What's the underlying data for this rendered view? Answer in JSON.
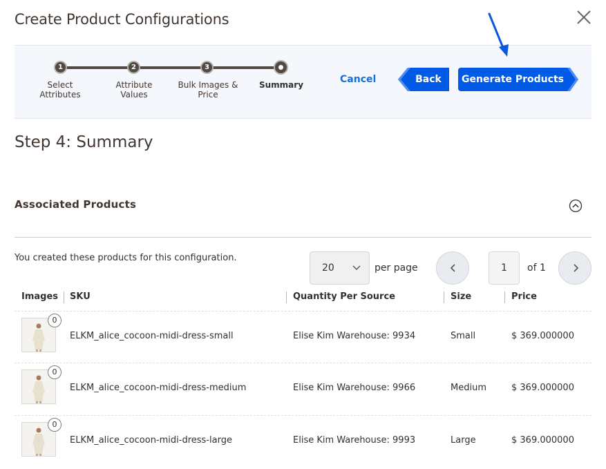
{
  "modal": {
    "title": "Create Product Configurations"
  },
  "wizard": {
    "steps": [
      {
        "number": "1",
        "label_line1": "Select",
        "label_line2": "Attributes"
      },
      {
        "number": "2",
        "label_line1": "Attribute",
        "label_line2": "Values"
      },
      {
        "number": "3",
        "label_line1": "Bulk Images &",
        "label_line2": "Price"
      },
      {
        "number": "",
        "label_line1": "Summary",
        "label_line2": ""
      }
    ],
    "cancel_label": "Cancel",
    "back_label": "Back",
    "generate_label": "Generate Products",
    "accent_color": "#1a6fd4",
    "button_color": "#005ae6"
  },
  "step_heading": "Step 4: Summary",
  "section": {
    "title": "Associated Products",
    "intro": "You created these products for this configuration."
  },
  "pager": {
    "per_page_value": "20",
    "per_page_label": "per page",
    "current_page": "1",
    "of_label": "of 1"
  },
  "table": {
    "headers": {
      "images": "Images",
      "sku": "SKU",
      "qty": "Quantity Per Source",
      "size": "Size",
      "price": "Price"
    },
    "rows": [
      {
        "image_count": "0",
        "sku": "ELKM_alice_cocoon-midi-dress-small",
        "qty": "Elise Kim Warehouse: 9934",
        "size": "Small",
        "price": "$ 369.000000"
      },
      {
        "image_count": "0",
        "sku": "ELKM_alice_cocoon-midi-dress-medium",
        "qty": "Elise Kim Warehouse: 9966",
        "size": "Medium",
        "price": "$ 369.000000"
      },
      {
        "image_count": "0",
        "sku": "ELKM_alice_cocoon-midi-dress-large",
        "qty": "Elise Kim Warehouse: 9993",
        "size": "Large",
        "price": "$ 369.000000"
      }
    ]
  },
  "icons": {
    "close": "close-icon",
    "collapse": "chevron-up-circle-icon",
    "dropdown": "chevron-down-icon",
    "prev": "chevron-left-icon",
    "next": "chevron-right-icon",
    "annotation": "arrow-down-annotation-icon"
  }
}
